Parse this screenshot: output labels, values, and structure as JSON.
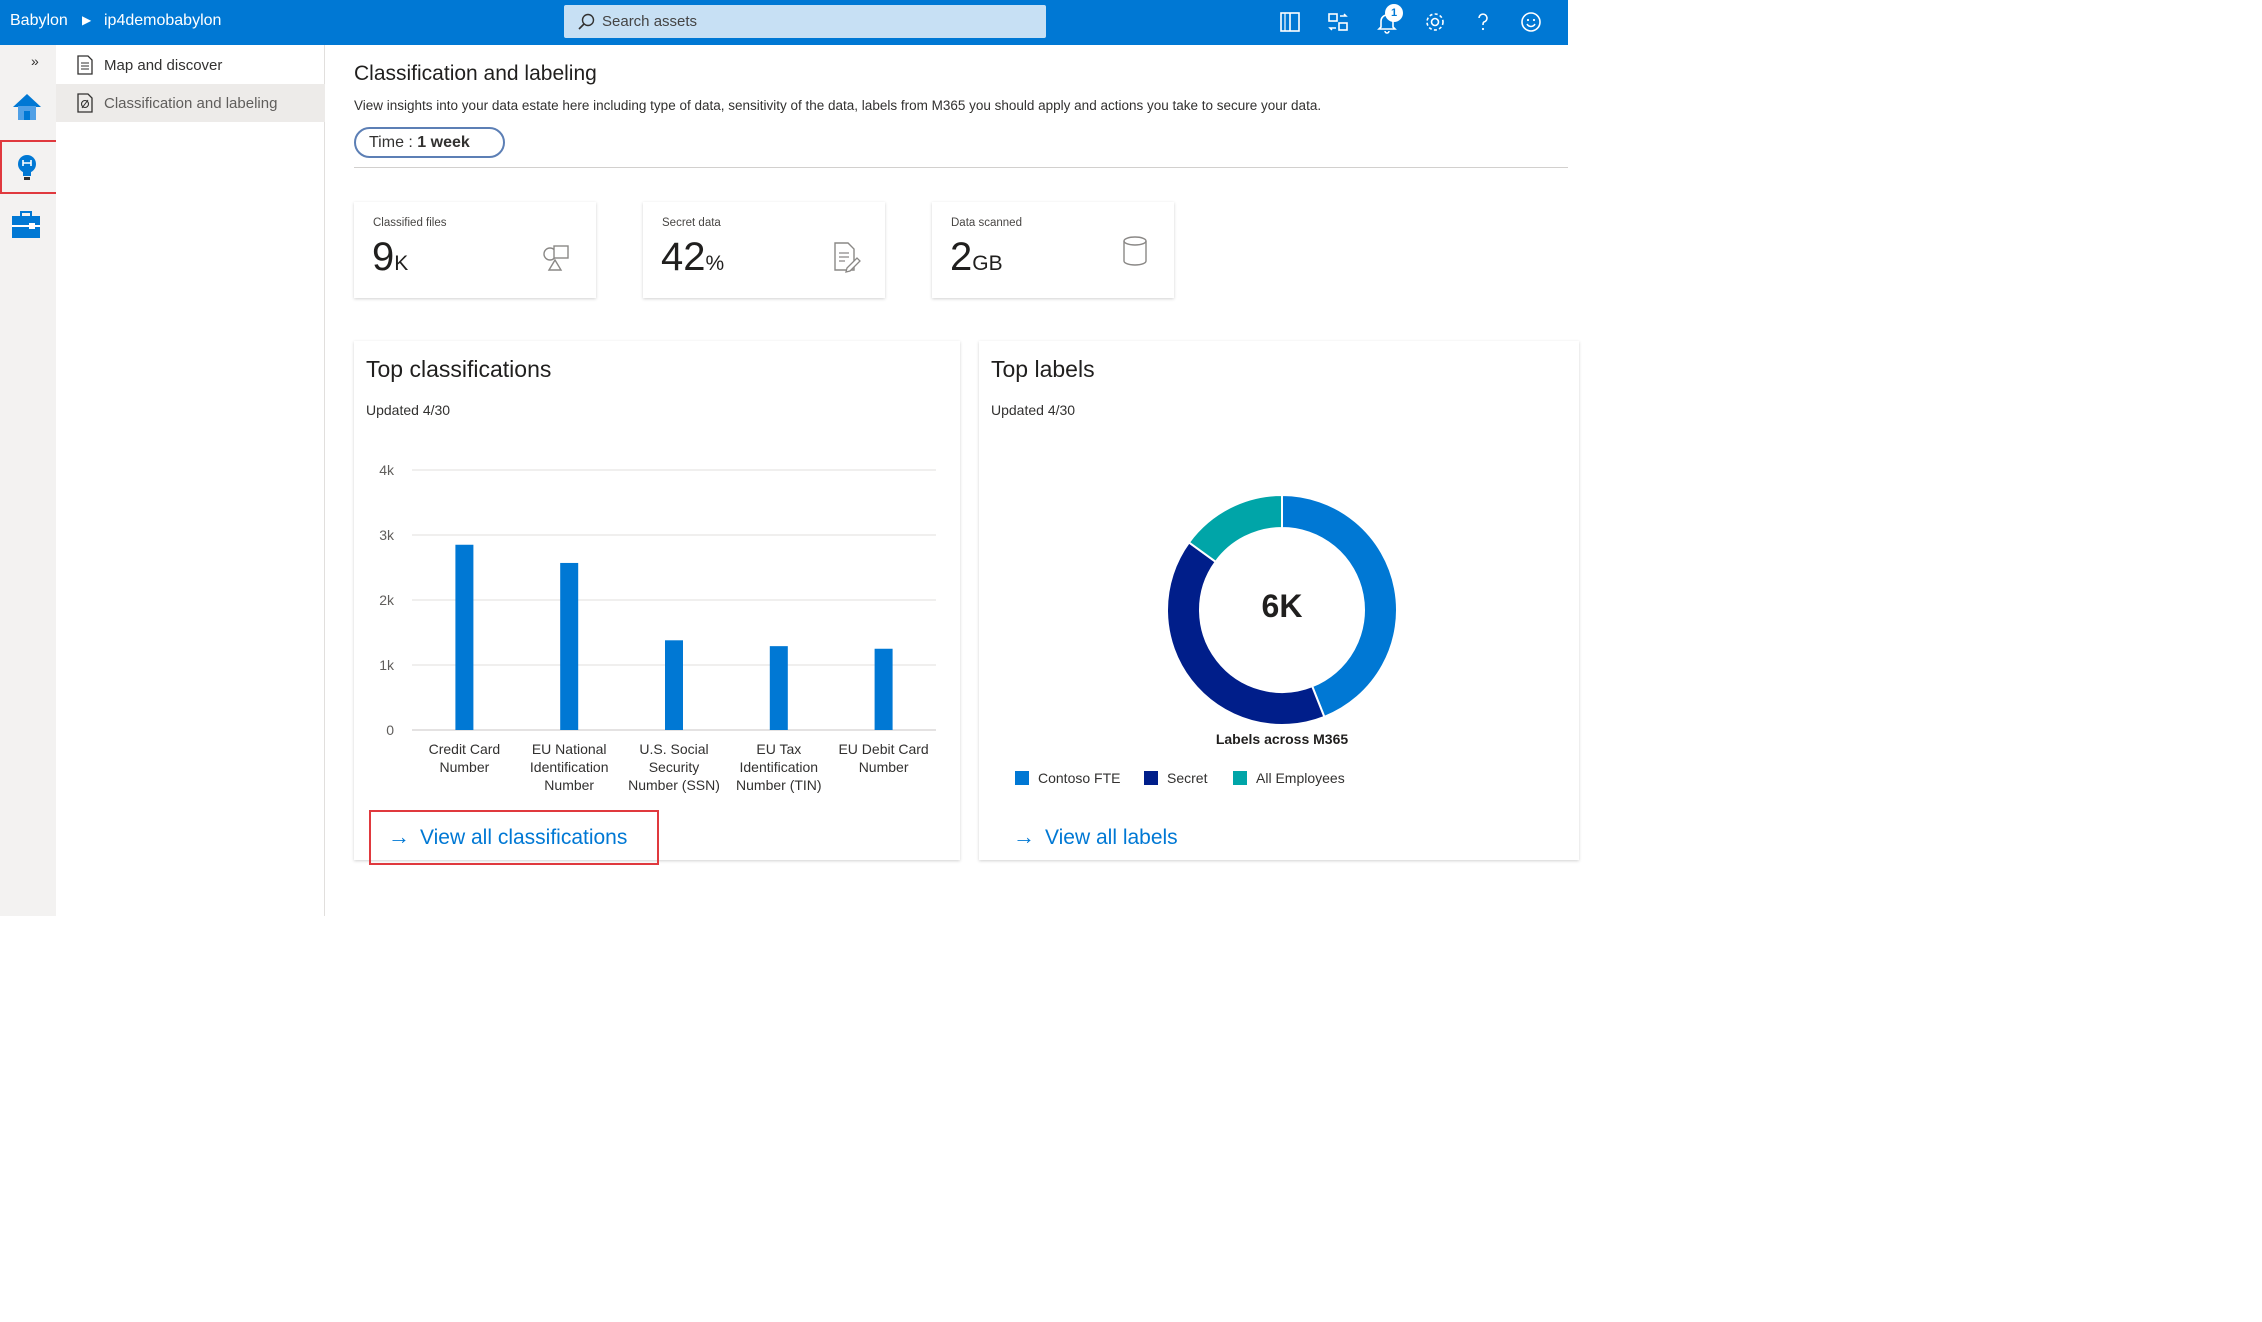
{
  "topbar": {
    "brand": "Babylon",
    "breadcrumb_sep": "▶",
    "breadcrumb": "ip4demobabylon",
    "search_placeholder": "Search assets",
    "notification_count": "1",
    "icons": [
      "book-icon",
      "switch-directory-icon",
      "bell-icon",
      "gear-icon",
      "help-icon",
      "feedback-smiley-icon"
    ]
  },
  "rail": {
    "expand": "»",
    "items": [
      "home-icon",
      "insights-lightbulb-icon",
      "management-toolbox-icon"
    ],
    "highlighted": "insights-lightbulb-icon"
  },
  "subnav": {
    "items": [
      {
        "label": "Map and discover",
        "active": false
      },
      {
        "label": "Classification and labeling",
        "active": true
      }
    ]
  },
  "main": {
    "title": "Classification and labeling",
    "description": "View insights into your data estate here including type of data, sensitivity of the data, labels from M365 you should apply and actions you take to secure your data.",
    "time_label": "Time : ",
    "time_value": "1 week"
  },
  "kpis": [
    {
      "label": "Classified files",
      "value": "9",
      "unit": "K",
      "icon": "shapes-icon"
    },
    {
      "label": "Secret data",
      "value": "42",
      "unit": "%",
      "icon": "document-edit-icon"
    },
    {
      "label": "Data scanned",
      "value": "2",
      "unit": "GB",
      "icon": "database-icon"
    }
  ],
  "top_classifications": {
    "title": "Top classifications",
    "updated": "Updated 4/30",
    "link": "View all classifications"
  },
  "top_labels": {
    "title": "Top labels",
    "updated": "Updated 4/30",
    "center_value": "6K",
    "caption": "Labels across M365",
    "link": "View all labels"
  },
  "chart_data": [
    {
      "type": "bar",
      "categories": [
        [
          "Credit Card",
          "Number"
        ],
        [
          "EU National",
          "Identification",
          "Number"
        ],
        [
          "U.S. Social",
          "Security",
          "Number (SSN)"
        ],
        [
          "EU Tax",
          "Identification",
          "Number (TIN)"
        ],
        [
          "EU Debit Card",
          "Number"
        ]
      ],
      "values": [
        2850,
        2570,
        1380,
        1290,
        1250
      ],
      "ylim": [
        0,
        4000
      ],
      "yticks": [
        "0",
        "1k",
        "2k",
        "3k",
        "4k"
      ],
      "ytick_values": [
        0,
        1000,
        2000,
        3000,
        4000
      ],
      "color": "#0078d4",
      "grid": true
    },
    {
      "type": "pie",
      "labels": [
        "Contoso FTE",
        "Secret",
        "All Employees"
      ],
      "values": [
        44,
        41,
        15
      ],
      "colors": [
        "#0078d4",
        "#001e8a",
        "#00a5a8"
      ],
      "legend": "bottom"
    }
  ]
}
